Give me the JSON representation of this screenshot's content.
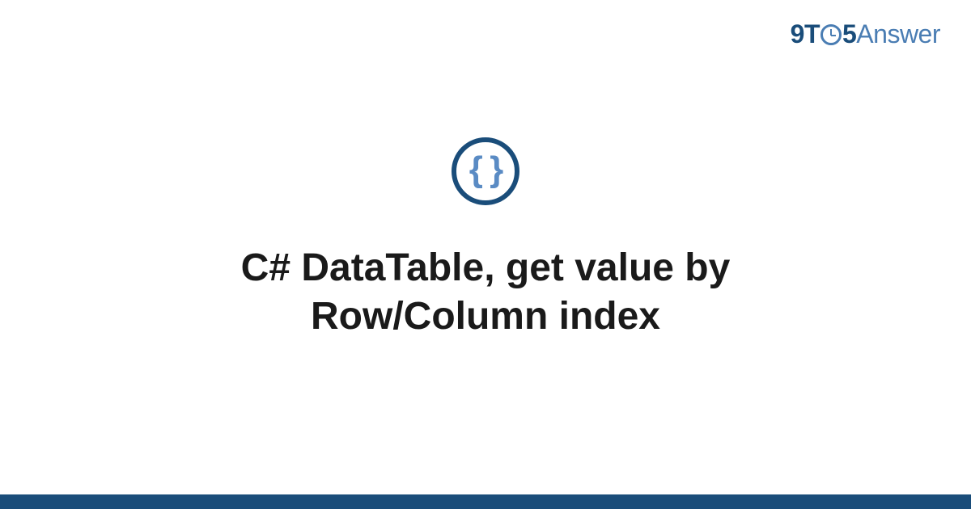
{
  "logo": {
    "part1": "9T",
    "part2": "5",
    "part3": "Answer"
  },
  "icon": {
    "name": "code-braces-icon",
    "glyph": "{ }"
  },
  "title": "C# DataTable, get value by Row/Column index",
  "colors": {
    "primary": "#1a4d7a",
    "accent": "#4a7db3",
    "text": "#1a1a1a"
  }
}
